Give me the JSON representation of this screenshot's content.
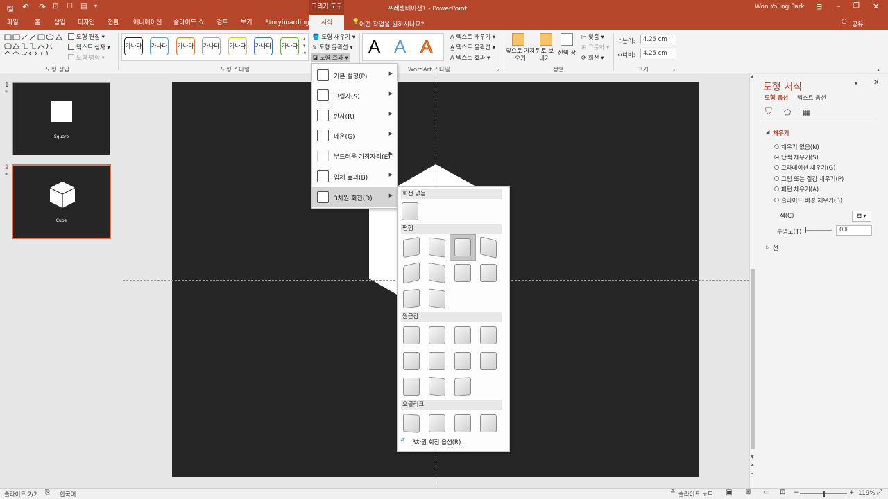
{
  "titlebar": {
    "doc_title": "프레젠테이션1 - PowerPoint",
    "context_header": "그리기 도구",
    "user": "Won Young Park",
    "qat_icons": [
      "save-icon",
      "undo-icon",
      "redo-icon",
      "start-presentation-icon",
      "touch-mode-icon",
      "customize-icon"
    ]
  },
  "tabs": [
    "파일",
    "홈",
    "삽입",
    "디자인",
    "전환",
    "애니메이션",
    "슬라이드 쇼",
    "검토",
    "보기",
    "Storyboarding",
    "서식"
  ],
  "active_tab": "서식",
  "tell_me": "어떤 작업을 원하시나요?",
  "share": "공유",
  "ribbon": {
    "groups": [
      "도형 삽입",
      "도형 스타일",
      "WordArt 스타일",
      "정렬",
      "크기"
    ],
    "insert_shapes": {
      "edit_shape": "도형 편집",
      "text_box": "텍스트 상자",
      "merge_shapes": "도형 병합"
    },
    "shape_styles": {
      "sample_text": "가나다",
      "style_colors": [
        "#222222",
        "#5b9bd5",
        "#ed7d31",
        "#a5a5a5",
        "#ffc000",
        "#4472c4",
        "#70ad47"
      ]
    },
    "shape_fill": "도형 채우기",
    "shape_outline": "도형 윤곽선",
    "shape_effects": "도형 효과",
    "wordart": {
      "letter": "A",
      "colors": [
        "#000000",
        "#5b9bd5",
        "#ed7d31"
      ],
      "text_fill": "텍스트 채우기",
      "text_outline": "텍스트 윤곽선",
      "text_effects": "텍스트 효과"
    },
    "arrange": {
      "bring_forward": "앞으로 가져오기",
      "send_backward": "뒤로 보내기",
      "selection_pane": "선택 창",
      "align": "맞춤",
      "group": "그룹화",
      "rotate": "회전"
    },
    "size": {
      "height_label": "높이:",
      "height": "4.25 cm",
      "width_label": "너비:",
      "width": "4.25 cm"
    }
  },
  "slides": [
    {
      "num": "1",
      "caption": "Square"
    },
    {
      "num": "2",
      "caption": "Cube"
    }
  ],
  "effects_menu": {
    "items": [
      "기본 설정(P)",
      "그림자(S)",
      "반사(R)",
      "네온(G)",
      "부드러운 가장자리(E)",
      "입체 효과(B)",
      "3차원 회전(D)"
    ],
    "highlighted": "3차원 회전(D)"
  },
  "rotation_gallery": {
    "sections": [
      "회전 없음",
      "평행",
      "원근감",
      "오블리크"
    ],
    "counts": [
      1,
      10,
      11,
      4
    ],
    "footer": "3차원 회전 옵션(R)..."
  },
  "format_pane": {
    "title": "도형 서식",
    "tab_shape": "도형 옵션",
    "tab_text": "텍스트 옵션",
    "fill_section": "채우기",
    "fill_options": [
      "채우기 없음(N)",
      "단색 채우기(S)",
      "그라데이션 채우기(G)",
      "그림 또는 질감 채우기(P)",
      "패턴 채우기(A)",
      "슬라이드 배경 채우기(B)"
    ],
    "fill_selected": 1,
    "color_label": "색(C)",
    "transparency_label": "투명도(T)",
    "transparency": "0%",
    "line_section": "선"
  },
  "status": {
    "slide": "슬라이드 2/2",
    "language": "한국어",
    "notes": "슬라이드 노트",
    "zoom": "119%"
  }
}
